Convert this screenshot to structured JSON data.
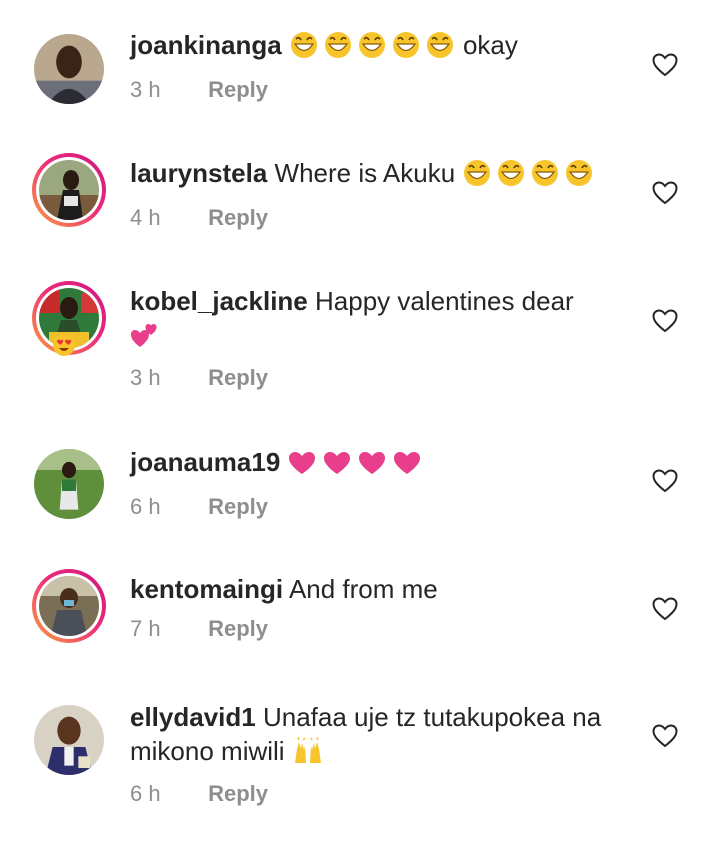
{
  "comments": [
    {
      "username": "joankinanga",
      "text": "okay",
      "emoji_prefix": "😂😂😂😂😂",
      "time": "3 h",
      "reply": "Reply",
      "avatar_icon": "profile-photo-woman-icon",
      "story_ring": false
    },
    {
      "username": "laurynstela",
      "text": "Where is Akuku",
      "emoji_suffix": "😂😂😂😂",
      "time": "4 h",
      "reply": "Reply",
      "avatar_icon": "profile-photo-woman-icon",
      "story_ring": true
    },
    {
      "username": "kobel_jackline",
      "text": "Happy valentines dear",
      "emoji_suffix": "💕",
      "time": "3 h",
      "reply": "Reply",
      "avatar_icon": "profile-photo-woman-icon",
      "story_ring": true
    },
    {
      "username": "joanauma19",
      "text": "",
      "emoji_suffix": "❤❤❤❤",
      "time": "6 h",
      "reply": "Reply",
      "avatar_icon": "profile-photo-woman-icon",
      "story_ring": false
    },
    {
      "username": "kentomaingi",
      "text": "And from me",
      "time": "7 h",
      "reply": "Reply",
      "avatar_icon": "profile-photo-man-icon",
      "story_ring": true
    },
    {
      "username": "ellydavid1",
      "text": "Unafaa uje tz tutakupokea na mikono miwili",
      "emoji_suffix": "🙌",
      "time": "6 h",
      "reply": "Reply",
      "avatar_icon": "profile-photo-man-icon",
      "story_ring": false
    }
  ],
  "colors": {
    "username": "#262626",
    "meta": "#8e8e8e",
    "story_ring_start": "#f9a33b",
    "story_ring_end": "#c8197e",
    "heart_emoji": "#e83e8c",
    "laugh_emoji": "#f7c52b"
  }
}
